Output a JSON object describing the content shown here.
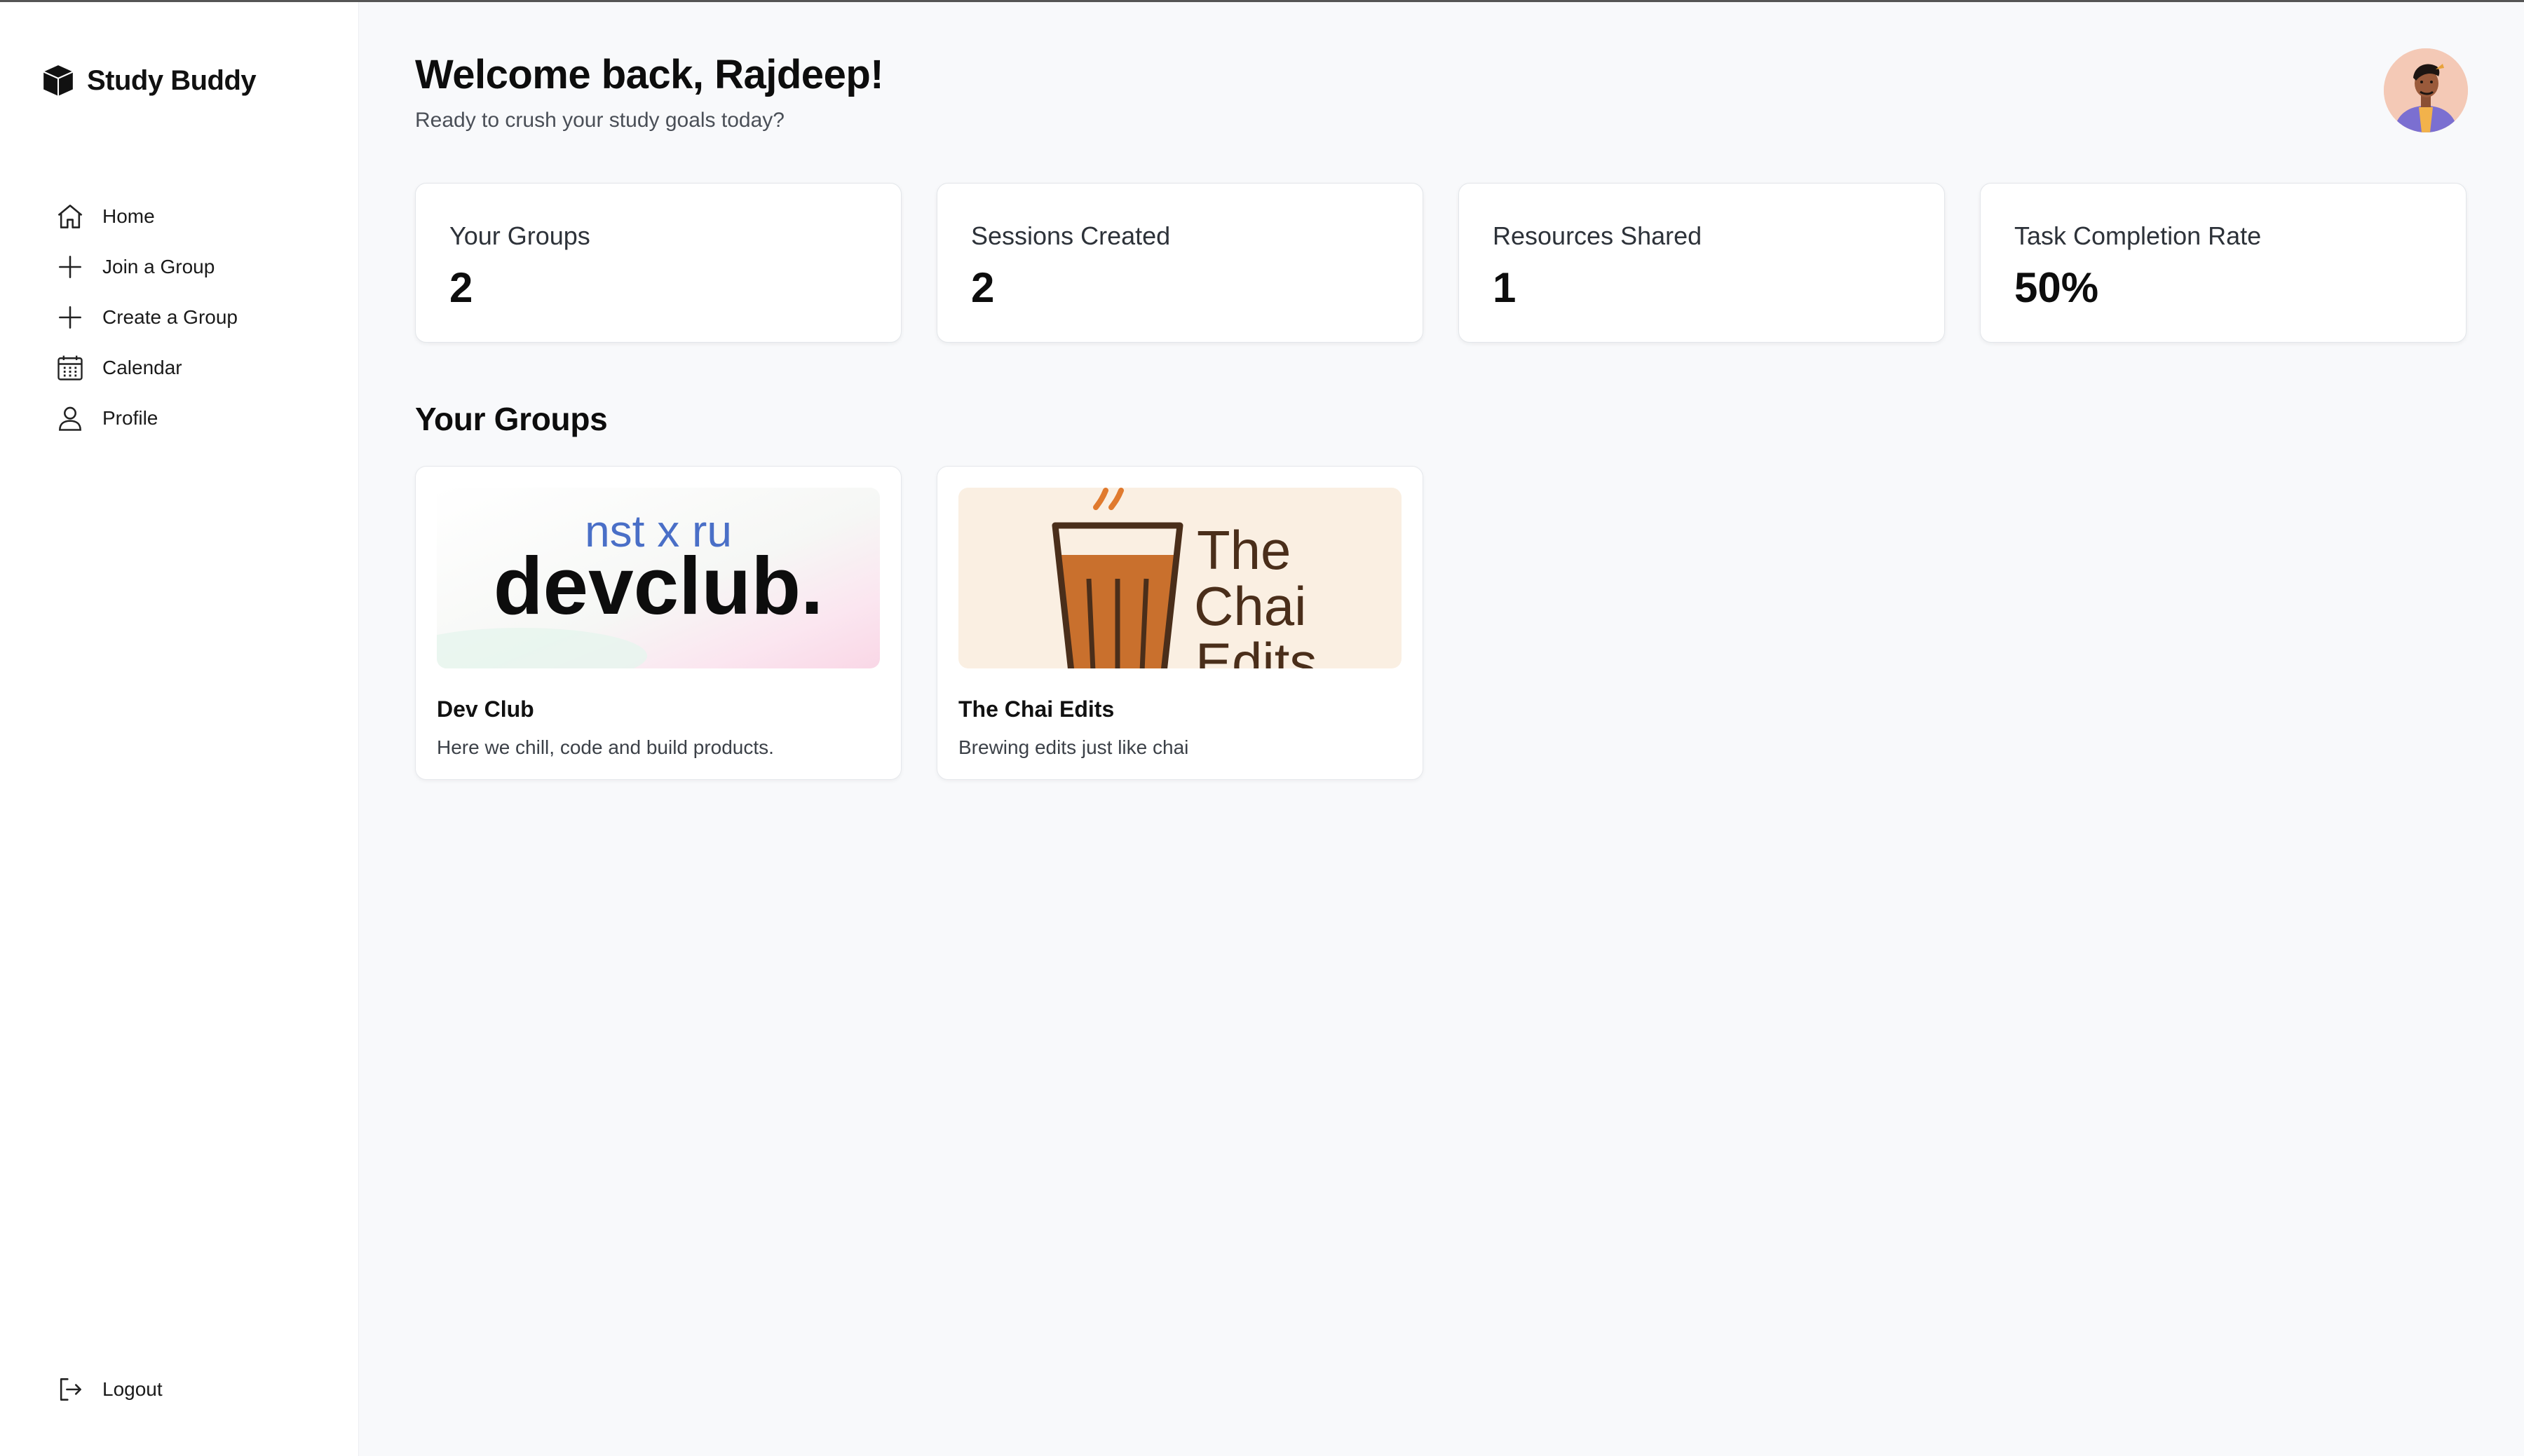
{
  "app": {
    "name": "Study Buddy"
  },
  "sidebar": {
    "items": [
      {
        "label": "Home",
        "icon": "home-icon"
      },
      {
        "label": "Join a Group",
        "icon": "plus-icon"
      },
      {
        "label": "Create a Group",
        "icon": "plus-icon"
      },
      {
        "label": "Calendar",
        "icon": "calendar-icon"
      },
      {
        "label": "Profile",
        "icon": "user-icon"
      }
    ],
    "logout": {
      "label": "Logout",
      "icon": "logout-icon"
    }
  },
  "header": {
    "title": "Welcome back, Rajdeep!",
    "subtitle": "Ready to crush your study goals today?",
    "avatar_icon": "user-avatar"
  },
  "stats": [
    {
      "label": "Your Groups",
      "value": "2"
    },
    {
      "label": "Sessions Created",
      "value": "2"
    },
    {
      "label": "Resources Shared",
      "value": "1"
    },
    {
      "label": "Task Completion Rate",
      "value": "50%"
    }
  ],
  "groups_section": {
    "title": "Your Groups",
    "groups": [
      {
        "name": "Dev Club",
        "description": "Here we chill, code and build products.",
        "image_text_top": "nst x ru",
        "image_text_main": "devclub."
      },
      {
        "name": "The Chai Edits",
        "description": "Brewing edits just like chai",
        "image_text_lines": [
          "The",
          "Chai",
          "Edits"
        ]
      }
    ]
  },
  "colors": {
    "background": "#f8f9fb",
    "sidebar": "#ffffff",
    "card_border": "#e3e6ea",
    "chai_bg": "#faefe2",
    "chai_brown": "#4a2e1a",
    "chai_orange": "#c9702d"
  }
}
